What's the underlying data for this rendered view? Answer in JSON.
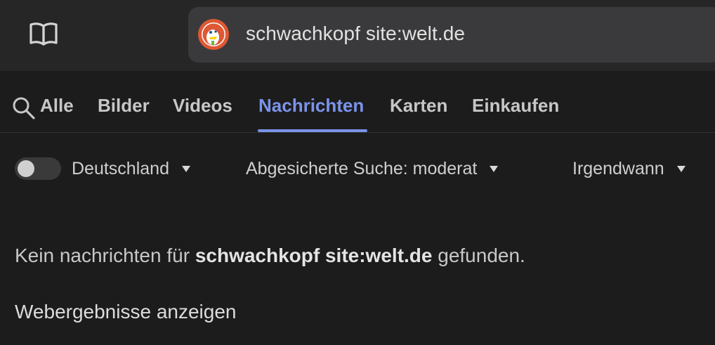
{
  "address_bar": {
    "query": "schwachkopf site:welt.de"
  },
  "tabs": [
    {
      "label": "Alle",
      "active": false
    },
    {
      "label": "Bilder",
      "active": false
    },
    {
      "label": "Videos",
      "active": false
    },
    {
      "label": "Nachrichten",
      "active": true
    },
    {
      "label": "Karten",
      "active": false
    },
    {
      "label": "Einkaufen",
      "active": false
    }
  ],
  "filters": {
    "region_toggle_on": false,
    "region": "Deutschland",
    "safe_search": "Abgesicherte Suche: moderat",
    "time": "Irgendwann"
  },
  "results": {
    "no_results_prefix": "Kein nachrichten für",
    "no_results_query": "schwachkopf site:welt.de",
    "no_results_suffix": "gefunden.",
    "web_results_link": "Webergebnisse anzeigen"
  },
  "colors": {
    "background": "#1c1c1c",
    "topbar": "#262626",
    "addressbar": "#3a3a3c",
    "accent": "#7b93ea"
  },
  "icons": {
    "reader": "book-icon",
    "search": "search-icon",
    "logo": "duckduckgo-logo"
  }
}
